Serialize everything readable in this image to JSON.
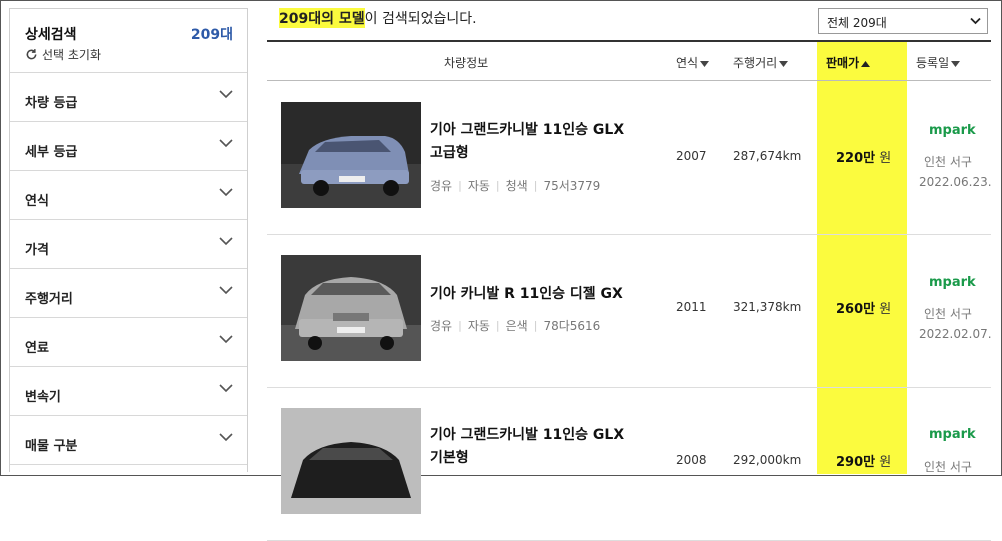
{
  "sidebar": {
    "title": "상세검색",
    "count": "209대",
    "reset": "선택 초기화",
    "items": [
      {
        "label": "차량 등급"
      },
      {
        "label": "세부 등급"
      },
      {
        "label": "연식"
      },
      {
        "label": "가격"
      },
      {
        "label": "주행거리"
      },
      {
        "label": "연료"
      },
      {
        "label": "변속기"
      },
      {
        "label": "매물 구분"
      }
    ]
  },
  "results": {
    "count_text": "209대의 모델",
    "suffix": "이 검색되었습니다.",
    "filter_select": "전체 209대"
  },
  "columns": {
    "info": "차량정보",
    "year": "연식",
    "mileage": "주행거리",
    "price": "판매가",
    "reg_date": "등록일"
  },
  "cars": [
    {
      "name_line1": "기아 그랜드카니발 11인승 GLX",
      "name_line2": "고급형",
      "fuel": "경유",
      "trans": "자동",
      "color": "청색",
      "plate": "75서3779",
      "year": "2007",
      "mileage": "287,674km",
      "price": "220만",
      "price_unit": "원",
      "dealer": "mpark",
      "location": "인천 서구",
      "date": "2022.06.23."
    },
    {
      "name_line1": "기아 카니발 R 11인승 디젤 GX",
      "name_line2": "",
      "fuel": "경유",
      "trans": "자동",
      "color": "은색",
      "plate": "78다5616",
      "year": "2011",
      "mileage": "321,378km",
      "price": "260만",
      "price_unit": "원",
      "dealer": "mpark",
      "location": "인천 서구",
      "date": "2022.02.07."
    },
    {
      "name_line1": "기아 그랜드카니발 11인승 GLX",
      "name_line2": "기본형",
      "year": "2008",
      "mileage": "292,000km",
      "price": "290만",
      "price_unit": "원",
      "dealer": "mpark",
      "location": "인천 서구"
    }
  ],
  "colors": {
    "highlight": "#fbfb3e",
    "count_blue": "#2e5aa8",
    "mpark_green": "#1a9a4a"
  }
}
